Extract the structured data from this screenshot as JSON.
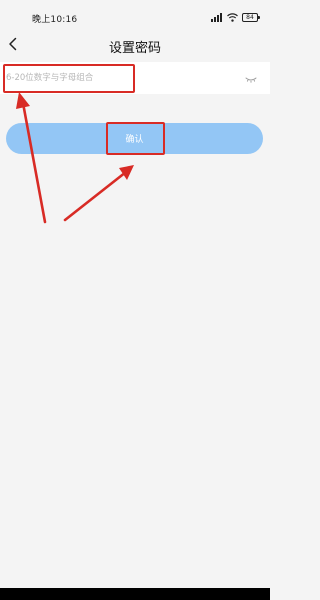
{
  "status_bar": {
    "time": "晚上10:16",
    "battery_level": "84",
    "icons": [
      "signal-icon",
      "wifi-icon",
      "battery-icon"
    ]
  },
  "nav": {
    "back_icon": "chevron-left-icon",
    "title": "设置密码"
  },
  "password_field": {
    "placeholder": "6-20位数字与字母组合",
    "value": "",
    "toggle_icon": "eye-closed-icon"
  },
  "confirm_button": {
    "label": "确认"
  },
  "colors": {
    "background": "#f4f4f4",
    "input_background": "#ffffff",
    "button_background": "#93c6f5",
    "annotation": "#d82b25"
  }
}
